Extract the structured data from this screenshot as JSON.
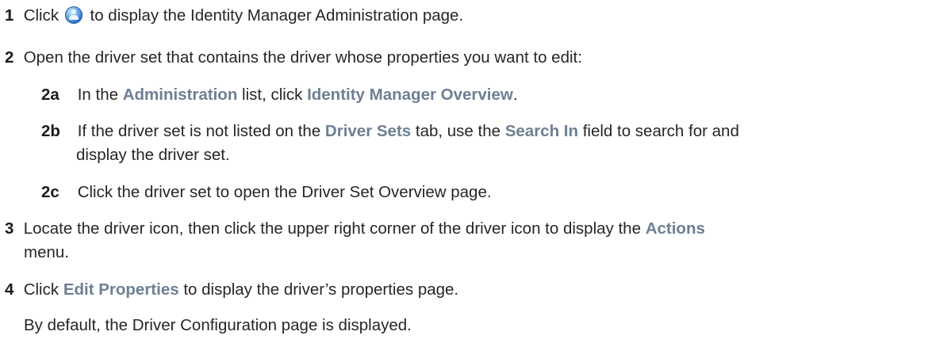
{
  "steps": {
    "s1": {
      "num": "1",
      "pre": "Click ",
      "post": " to display the Identity Manager Administration page."
    },
    "s2": {
      "num": "2",
      "text": "Open the driver set that contains the driver whose properties you want to edit:"
    },
    "s2a": {
      "num": "2a",
      "t1": "In the ",
      "ui1": "Administration",
      "t2": " list, click ",
      "ui2": "Identity Manager Overview",
      "t3": "."
    },
    "s2b": {
      "num": "2b",
      "t1": "If the driver set is not listed on the ",
      "ui1": "Driver Sets",
      "t2": " tab, use the ",
      "ui2": "Search In",
      "t3": " field to search for and",
      "cont": "display the driver set."
    },
    "s2c": {
      "num": "2c",
      "text": "Click the driver set to open the Driver Set Overview page."
    },
    "s3": {
      "num": "3",
      "t1": "Locate the driver icon, then click the upper right corner of the driver icon to display the ",
      "ui1": "Actions",
      "cont": "menu."
    },
    "s4": {
      "num": "4",
      "t1": "Click ",
      "ui1": "Edit Properties",
      "t2": " to display the driver’s properties page."
    },
    "note": "By default, the Driver Configuration page is displayed."
  },
  "icons": {
    "identity_manager": "identity-manager-globe-icon"
  }
}
